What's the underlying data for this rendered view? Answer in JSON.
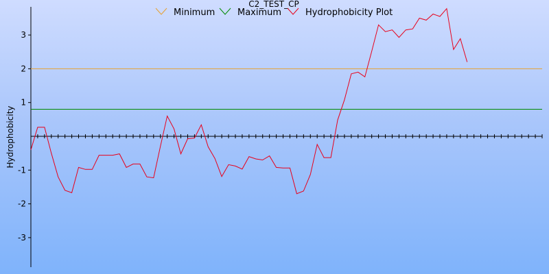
{
  "chart_data": {
    "type": "line",
    "title": "C2_TEST_CP",
    "xlabel": "",
    "ylabel": "Hydrophobicity",
    "ylim": [
      -3.8,
      3.8
    ],
    "yticks": [
      -3,
      -2,
      -1,
      1,
      2,
      3
    ],
    "grid": false,
    "legend_position": "top",
    "x_count": 76,
    "series": [
      {
        "name": "Minimum",
        "color": "#e8a030",
        "values": [
          2,
          2
        ]
      },
      {
        "name": "Maximum",
        "color": "#008a00",
        "values": [
          0.8,
          0.8
        ]
      },
      {
        "name": "Hydrophobicity Plot",
        "color": "#e8001a",
        "values": [
          -0.4,
          0.27,
          0.27,
          -0.5,
          -1.2,
          -1.6,
          -1.67,
          -0.92,
          -0.98,
          -0.98,
          -0.56,
          -0.56,
          -0.56,
          -0.52,
          -0.92,
          -0.82,
          -0.82,
          -1.2,
          -1.23,
          -0.3,
          0.6,
          0.22,
          -0.52,
          -0.07,
          -0.05,
          0.34,
          -0.31,
          -0.66,
          -1.19,
          -0.84,
          -0.88,
          -0.97,
          -0.6,
          -0.67,
          -0.7,
          -0.58,
          -0.92,
          -0.94,
          -0.94,
          -1.7,
          -1.62,
          -1.13,
          -0.24,
          -0.63,
          -0.63,
          0.48,
          1.08,
          1.85,
          1.9,
          1.76,
          2.52,
          3.3,
          3.1,
          3.15,
          2.93,
          3.15,
          3.18,
          3.5,
          3.44,
          3.62,
          3.55,
          3.78,
          2.57,
          2.89,
          2.2
        ]
      }
    ]
  }
}
